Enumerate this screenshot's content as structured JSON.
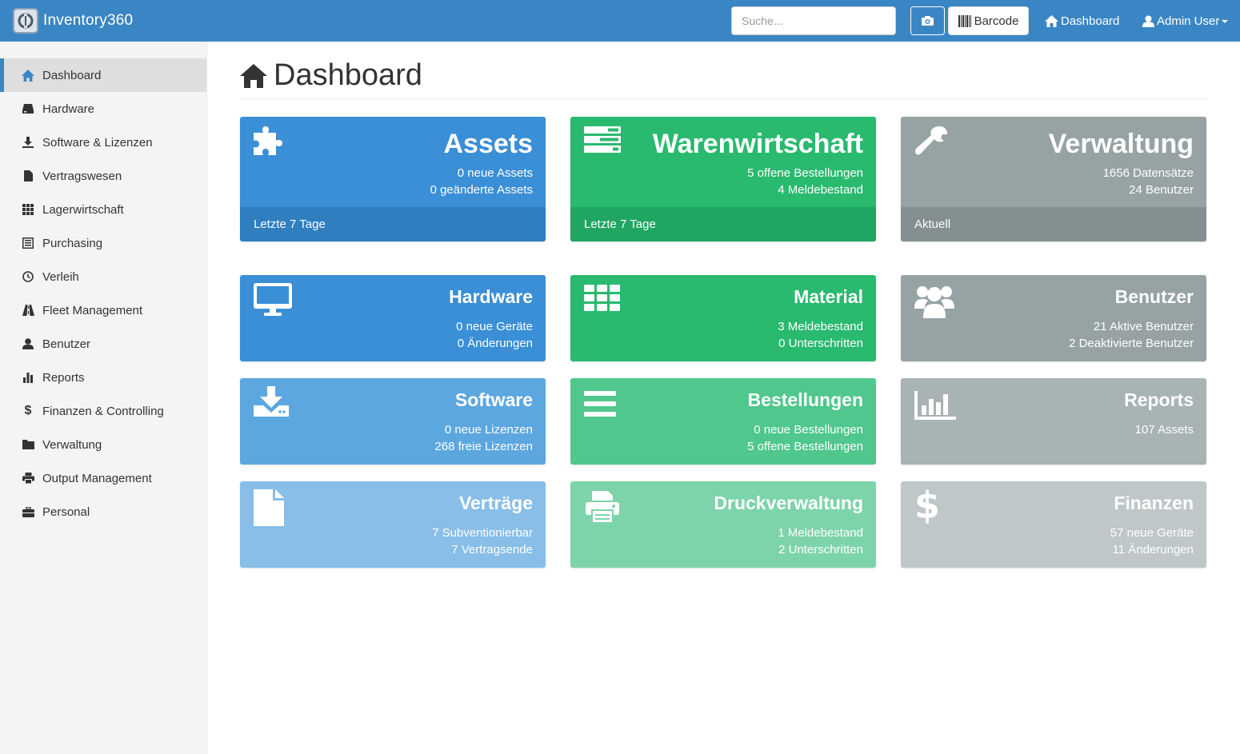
{
  "app": {
    "name": "Inventory360"
  },
  "topbar": {
    "search_placeholder": "Suche...",
    "barcode_label": "Barcode",
    "dashboard_label": "Dashboard",
    "user_label": "Admin User"
  },
  "sidebar": {
    "items": [
      {
        "label": "Dashboard",
        "icon": "home-icon",
        "active": true
      },
      {
        "label": "Hardware",
        "icon": "hdd-icon"
      },
      {
        "label": "Software & Lizenzen",
        "icon": "download-icon"
      },
      {
        "label": "Vertragswesen",
        "icon": "file-icon"
      },
      {
        "label": "Lagerwirtschaft",
        "icon": "grid-icon"
      },
      {
        "label": "Purchasing",
        "icon": "list-alt-icon"
      },
      {
        "label": "Verleih",
        "icon": "clock-icon"
      },
      {
        "label": "Fleet Management",
        "icon": "road-icon"
      },
      {
        "label": "Benutzer",
        "icon": "user-icon"
      },
      {
        "label": "Reports",
        "icon": "bar-chart-icon"
      },
      {
        "label": "Finanzen & Controlling",
        "icon": "dollar-icon"
      },
      {
        "label": "Verwaltung",
        "icon": "folder-icon"
      },
      {
        "label": "Output Management",
        "icon": "print-icon"
      },
      {
        "label": "Personal",
        "icon": "briefcase-icon"
      }
    ]
  },
  "page": {
    "title": "Dashboard"
  },
  "tiles": {
    "assets": {
      "title": "Assets",
      "line1": "0 neue Assets",
      "line2": "0 geänderte Assets",
      "footer": "Letzte 7 Tage",
      "icon": "puzzle-icon",
      "color": "#3a8fd6"
    },
    "warenwirtschaft": {
      "title": "Warenwirtschaft",
      "line1": "5 offene Bestellungen",
      "line2": "4 Meldebestand",
      "footer": "Letzte 7 Tage",
      "icon": "tasks-icon",
      "color": "#29b96f"
    },
    "verwaltung": {
      "title": "Verwaltung",
      "line1": "1656 Datensätze",
      "line2": "24 Benutzer",
      "footer": "Aktuell",
      "icon": "wrench-icon",
      "color": "#96a2a4"
    },
    "hardware": {
      "title": "Hardware",
      "line1": "0 neue Geräte",
      "line2": "0 Änderungen",
      "icon": "monitor-icon",
      "color": "#3a8fd6"
    },
    "material": {
      "title": "Material",
      "line1": "3 Meldebestand",
      "line2": "0 Unterschritten",
      "icon": "th-icon",
      "color": "#29b96f"
    },
    "benutzer": {
      "title": "Benutzer",
      "line1": "21 Aktive Benutzer",
      "line2": "2 Deaktivierte Benutzer",
      "icon": "users-icon",
      "color": "#96a2a4"
    },
    "software": {
      "title": "Software",
      "line1": "0 neue Lizenzen",
      "line2": "268 freie Lizenzen",
      "icon": "download-icon",
      "color": "#5da7e0"
    },
    "bestellungen": {
      "title": "Bestellungen",
      "line1": "0 neue Bestellungen",
      "line2": "5 offene Bestellungen",
      "icon": "list-icon",
      "color": "#4fc78d"
    },
    "reports": {
      "title": "Reports",
      "line1": "107 Assets",
      "icon": "bar-chart-icon",
      "color": "#a8b3b4"
    },
    "vertraege": {
      "title": "Verträge",
      "line1": "7 Subventionierbar",
      "line2": "7 Vertragsende",
      "icon": "file-icon",
      "color": "#88bee8"
    },
    "druckverwaltung": {
      "title": "Druckverwaltung",
      "line1": "1 Meldebestand",
      "line2": "2 Unterschritten",
      "icon": "print-icon",
      "color": "#7dd4aa"
    },
    "finanzen": {
      "title": "Finanzen",
      "line1": "57 neue Geräte",
      "line2": "11 Änderungen",
      "icon": "dollar-icon",
      "color": "#bfc7c8"
    }
  }
}
